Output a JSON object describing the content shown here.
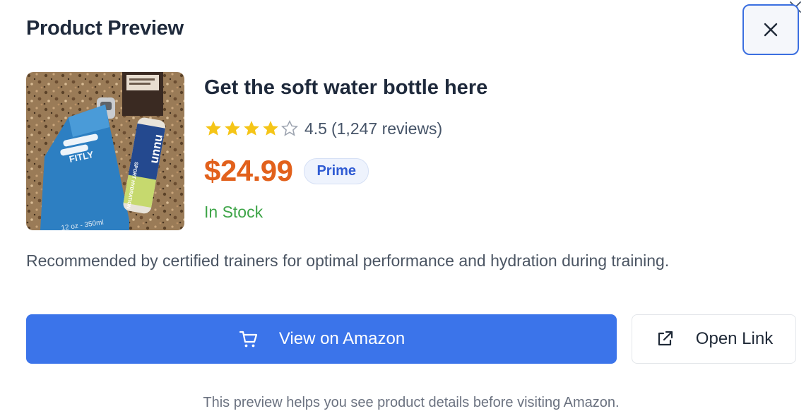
{
  "dialog": {
    "title": "Product Preview"
  },
  "product": {
    "name": "Get the soft water bottle here",
    "rating": "4.5",
    "rating_value": 4.5,
    "rating_max": 5,
    "reviews": "(1,247 reviews)",
    "price": "$24.99",
    "badge": "Prime",
    "stock_status": "In Stock",
    "description": "Recommended by certified trainers for optimal performance and hydration during training.",
    "image_text": {
      "brand": "FITLY",
      "volume": "12 oz - 350ml",
      "tube_brand": "nuun",
      "tube_label": "SPORT HYDRATION"
    }
  },
  "actions": {
    "primary_label": "View on Amazon",
    "primary_icon": "cart-icon",
    "secondary_label": "Open Link",
    "secondary_icon": "external-link-icon",
    "close_icon": "close-icon"
  },
  "footer": {
    "note": "This preview helps you see product details before visiting Amazon."
  },
  "colors": {
    "accent": "#3b74ea",
    "price": "#e2611c",
    "in_stock": "#3ea548",
    "star": "#f5c518"
  }
}
